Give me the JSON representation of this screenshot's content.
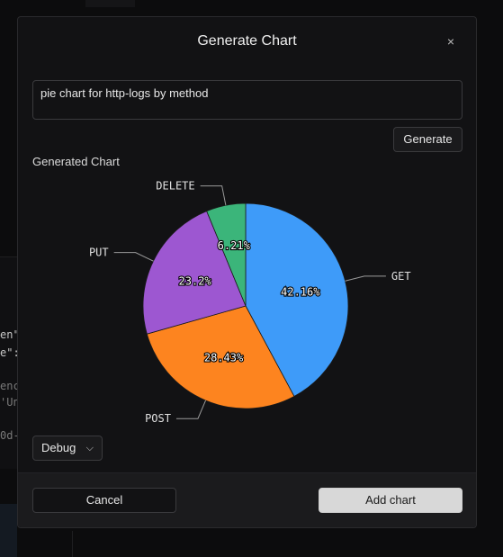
{
  "background": {
    "code_lines": [
      {
        "text": "en\"",
        "dim": false
      },
      {
        "text": "e\":",
        "dim": false
      },
      {
        "text": "enc",
        "dim": true
      },
      {
        "text": "'Un",
        "dim": true
      },
      {
        "text": "0d-",
        "dim": true
      }
    ]
  },
  "dialog": {
    "title": "Generate Chart",
    "close_icon": "×",
    "prompt_value": "pie chart for http-logs by method",
    "generate_label": "Generate",
    "section_label": "Generated Chart",
    "debug_label": "Debug",
    "debug_chevron": "⌵",
    "cancel_label": "Cancel",
    "add_label": "Add chart"
  },
  "chart_data": {
    "type": "pie",
    "categories": [
      "GET",
      "POST",
      "PUT",
      "DELETE"
    ],
    "values": [
      42.16,
      28.43,
      23.2,
      6.21
    ],
    "value_labels": [
      "42.16%",
      "28.43%",
      "23.2%",
      "6.21%"
    ],
    "colors": [
      "#3e9bf9",
      "#fd841f",
      "#9d57d1",
      "#3bb57a"
    ]
  }
}
